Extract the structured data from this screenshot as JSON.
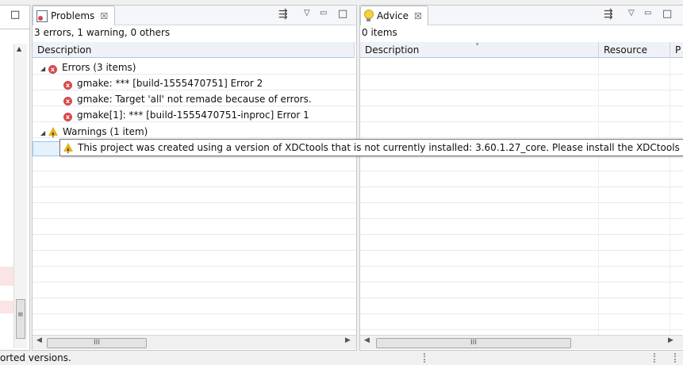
{
  "left_strip": {
    "maximize_glyph": "□",
    "up_arrow": "▲",
    "scroll_grip": "≡"
  },
  "problems": {
    "tab_label": "Problems",
    "tab_close": "☒",
    "status": "3 errors, 1 warning, 0 others",
    "column_description": "Description",
    "groups": {
      "errors": {
        "label": "Errors (3 items)",
        "items": [
          "gmake: *** [build-1555470751] Error 2",
          "gmake: Target 'all' not remade because of errors.",
          "gmake[1]: *** [build-1555470751-inproc] Error 1"
        ]
      },
      "warnings": {
        "label": "Warnings (1 item)"
      }
    },
    "scroll_thumb": "III",
    "toolbar": {
      "filter": "⇶",
      "menu": "▽",
      "minimize": "▭",
      "maximize": "□"
    }
  },
  "advice": {
    "tab_label": "Advice",
    "tab_close": "☒",
    "status": "0 items",
    "columns": [
      "Description",
      "Resource",
      "P"
    ],
    "scroll_thumb": "III",
    "toolbar": {
      "filter": "⇶",
      "menu": "▽",
      "minimize": "▭",
      "maximize": "□"
    }
  },
  "tooltip": {
    "text": "This project was created using a version of XDCtools that is not currently installed: 3.60.1.27_core. Please install the XDCtools of this"
  },
  "statusbar": {
    "message": "orted versions."
  },
  "colors": {
    "error": "#d84a4a",
    "warning": "#e6b21a",
    "header_bg": "#eef2f7"
  },
  "icons": {
    "problems": "problems-view-icon",
    "advice": "lightbulb-icon",
    "error": "error-icon",
    "warning": "warning-icon"
  }
}
